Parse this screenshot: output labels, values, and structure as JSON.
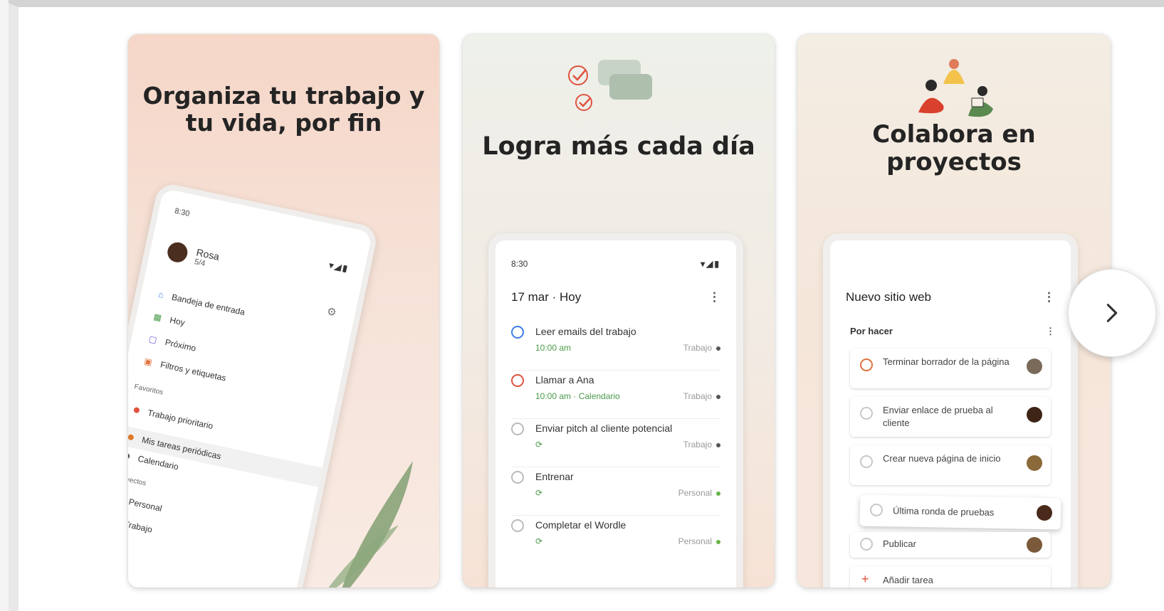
{
  "cards": [
    {
      "title": "Organiza tu trabajo y tu vida, por fin",
      "phone": {
        "time": "8:30",
        "user": {
          "name": "Rosa",
          "count": "5/4"
        },
        "nav": [
          "Bandeja de entrada",
          "Hoy",
          "Próximo",
          "Filtros y etiquetas"
        ],
        "favorites_label": "Favoritos",
        "favorites": [
          "Trabajo prioritario",
          "Mis tareas periódicas",
          "Calendario"
        ],
        "projects_label": "Proyectos",
        "projects": [
          "Personal",
          "Trabajo"
        ]
      }
    },
    {
      "title": "Logra más cada día",
      "phone": {
        "time": "8:30",
        "header": "17 mar · Hoy",
        "tasks": [
          {
            "title": "Leer emails del trabajo",
            "meta": "10:00 am",
            "project": "Trabajo"
          },
          {
            "title": "Llamar a Ana",
            "meta": "10:00 am · Calendario",
            "project": "Trabajo"
          },
          {
            "title": "Enviar pitch al cliente potencial",
            "meta": "",
            "project": "Trabajo"
          },
          {
            "title": "Entrenar",
            "meta": "",
            "project": "Personal"
          },
          {
            "title": "Completar el Wordle",
            "meta": "",
            "project": "Personal"
          }
        ]
      }
    },
    {
      "title": "Colabora en proyectos",
      "phone": {
        "header": "Nuevo sitio web",
        "section": "Por hacer",
        "tasks": [
          "Terminar borrador de la página",
          "Enviar enlace de prueba al cliente",
          "Crear nueva página de inicio",
          "Última ronda de pruebas",
          "Publicar"
        ],
        "add_task": "Añadir tarea"
      }
    }
  ],
  "colors": {
    "accent_red": "#e0533f",
    "blue": "#3f7ee8",
    "green_dot": "#6bb34a",
    "gray_dot": "#555555"
  },
  "icons": {
    "next": "chevron-right-icon"
  }
}
